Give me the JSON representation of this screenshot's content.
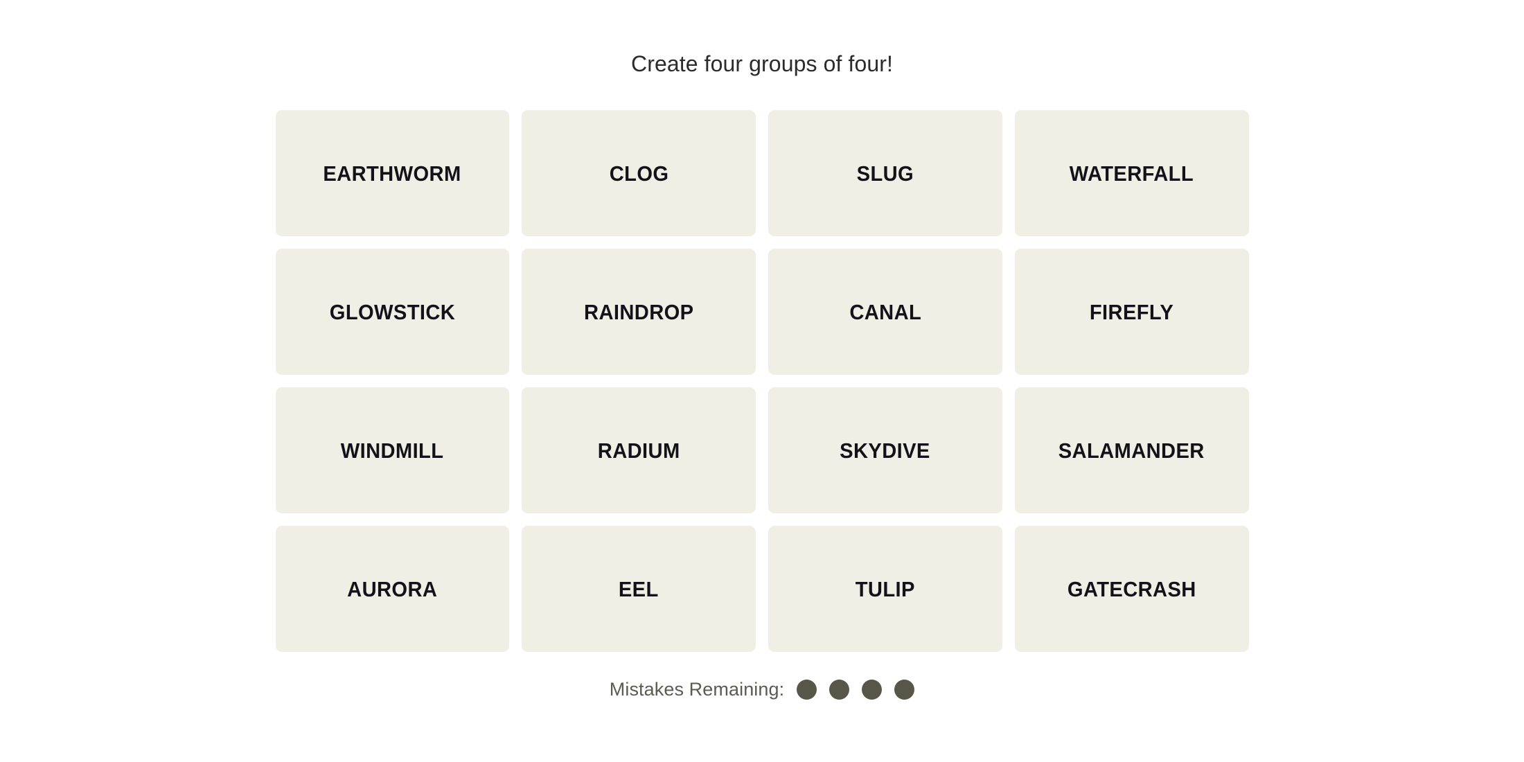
{
  "game": {
    "title": "Create four groups of four!",
    "tile_bg_color": "#EFEFE6",
    "tile_text_color": "#121218",
    "page_bg_color": "#FFFFFF",
    "title_color": "#2B2B2B"
  },
  "board": {
    "rows": 4,
    "columns": 4,
    "tiles": [
      {
        "label": "EARTHWORM"
      },
      {
        "label": "CLOG"
      },
      {
        "label": "SLUG"
      },
      {
        "label": "WATERFALL"
      },
      {
        "label": "GLOWSTICK"
      },
      {
        "label": "RAINDROP"
      },
      {
        "label": "CANAL"
      },
      {
        "label": "FIREFLY"
      },
      {
        "label": "WINDMILL"
      },
      {
        "label": "RADIUM"
      },
      {
        "label": "SKYDIVE"
      },
      {
        "label": "SALAMANDER"
      },
      {
        "label": "AURORA"
      },
      {
        "label": "EEL"
      },
      {
        "label": "TULIP"
      },
      {
        "label": "GATECRASH"
      }
    ]
  },
  "footer": {
    "mistakes_label": "Mistakes Remaining:",
    "mistakes_remaining": 4,
    "dot_color": "#575749",
    "label_color": "#5B5B53",
    "dots": [
      {
        "filled": true
      },
      {
        "filled": true
      },
      {
        "filled": true
      },
      {
        "filled": true
      }
    ]
  }
}
